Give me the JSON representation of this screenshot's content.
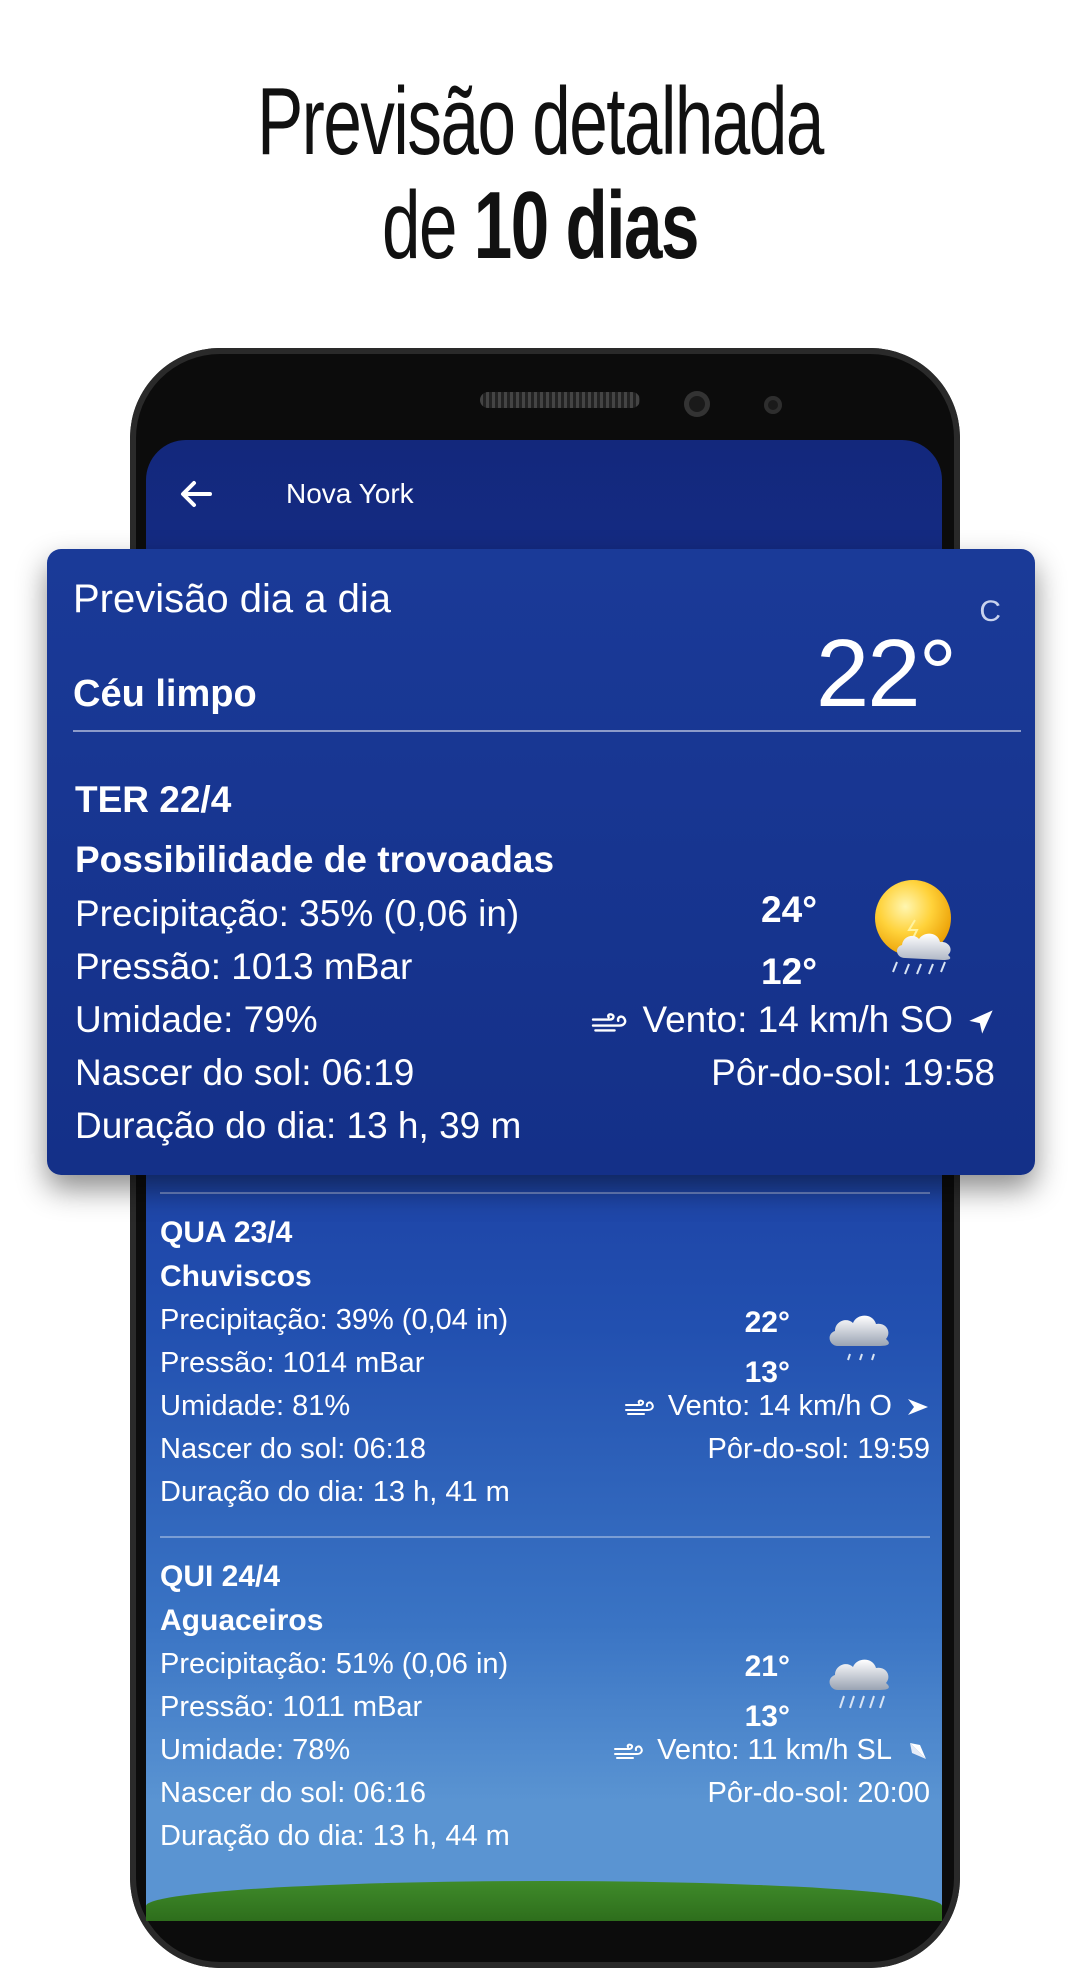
{
  "headline": {
    "line1": "Previsão detalhada",
    "line2_prefix": "de",
    "line2_bold": "10 dias"
  },
  "appbar": {
    "back_icon": "arrow-left-icon",
    "title": "Nova York"
  },
  "card": {
    "title": "Previsão dia a dia",
    "unit": "C",
    "current_temp": "22°",
    "sky": "Céu limpo",
    "day": {
      "date": "TER 22/4",
      "condition": "Possibilidade de trovoadas",
      "precip": "Precipitação: 35% (0,06 in)",
      "pressure": "Pressão: 1013 mBar",
      "humidity": "Umidade: 79%",
      "wind": "Vento: 14 km/h SO",
      "sunrise": "Nascer do sol: 06:19",
      "sunset": "Pôr-do-sol: 19:58",
      "daylength": "Duração do dia: 13 h, 39 m",
      "high": "24°",
      "low": "12°",
      "icon": "sun-thunder-cloud-icon"
    }
  },
  "days": [
    {
      "date": "QUA 23/4",
      "condition": "Chuviscos",
      "precip": "Precipitação: 39% (0,04 in)",
      "pressure": "Pressão: 1014 mBar",
      "humidity": "Umidade: 81%",
      "wind": "Vento: 14 km/h O",
      "sunrise": "Nascer do sol: 06:18",
      "sunset": "Pôr-do-sol: 19:59",
      "daylength": "Duração do dia: 13 h, 41 m",
      "high": "22°",
      "low": "13°",
      "icon": "drizzle-cloud-icon"
    },
    {
      "date": "QUI 24/4",
      "condition": "Aguaceiros",
      "precip": "Precipitação: 51% (0,06 in)",
      "pressure": "Pressão: 1011 mBar",
      "humidity": "Umidade: 78%",
      "wind": "Vento: 11 km/h SL",
      "sunrise": "Nascer do sol: 06:16",
      "sunset": "Pôr-do-sol: 20:00",
      "daylength": "Duração do dia: 13 h, 44 m",
      "high": "21°",
      "low": "13°",
      "icon": "rain-cloud-icon"
    }
  ],
  "colors": {
    "card_bg": "#1a3a98",
    "screen_top": "#13287c",
    "screen_bottom": "#5a94d2",
    "text": "#ffffff"
  }
}
